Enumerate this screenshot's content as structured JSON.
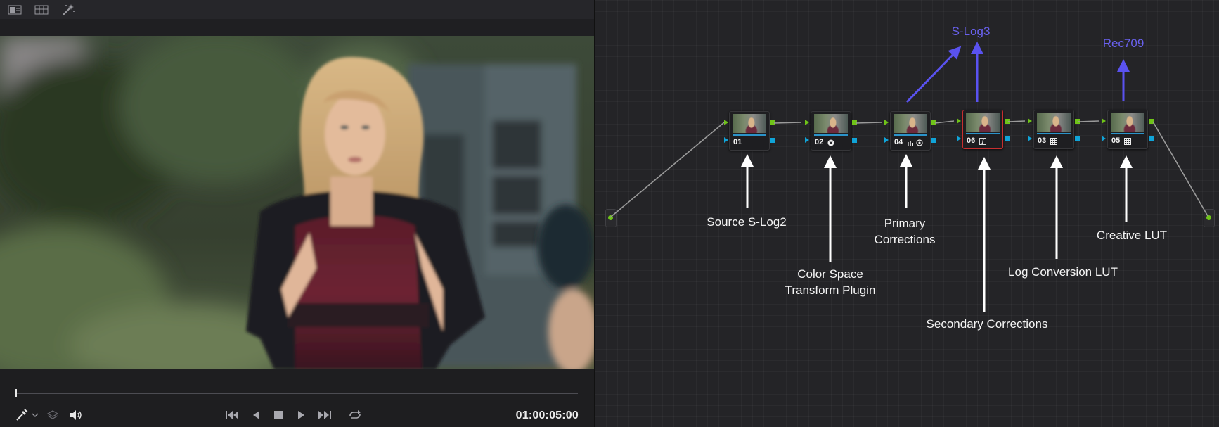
{
  "viewer": {
    "timecode": "01:00:05:00",
    "toolbar_icons": [
      "single-viewer-icon",
      "split-viewer-icon",
      "magic-wand-icon"
    ],
    "control_icons": [
      "picker-icon",
      "chevron-down-icon",
      "layers-icon",
      "speaker-icon",
      "skip-back-icon",
      "play-reverse-icon",
      "stop-icon",
      "play-icon",
      "skip-forward-icon",
      "loop-icon"
    ],
    "playhead_progress": 0.0
  },
  "node_editor": {
    "nodes": [
      {
        "number": "01",
        "icon": null,
        "selected": false
      },
      {
        "number": "02",
        "icon": "color-space-transform-icon",
        "selected": false
      },
      {
        "number": "04",
        "icon": "primaries-icon",
        "selected": false
      },
      {
        "number": "06",
        "icon": "curves-icon",
        "selected": true
      },
      {
        "number": "03",
        "icon": "lut-grid-icon",
        "selected": false
      },
      {
        "number": "05",
        "icon": "lut-grid-icon",
        "selected": false
      }
    ],
    "annotations": {
      "source": [
        "Source S-Log2"
      ],
      "cst": [
        "Color Space",
        "Transform Plugin"
      ],
      "primary": [
        "Primary",
        "Corrections"
      ],
      "secondary": [
        "Secondary Corrections"
      ],
      "log_lut": [
        "Log Conversion LUT"
      ],
      "creative": [
        "Creative LUT"
      ],
      "slog3": "S-Log3",
      "rec709": "Rec709"
    },
    "colors": {
      "annotation_blue": "#6961ee",
      "output_green": "#6fc418",
      "key_blue": "#10a4d8",
      "selected_red": "#c72f2f"
    }
  }
}
